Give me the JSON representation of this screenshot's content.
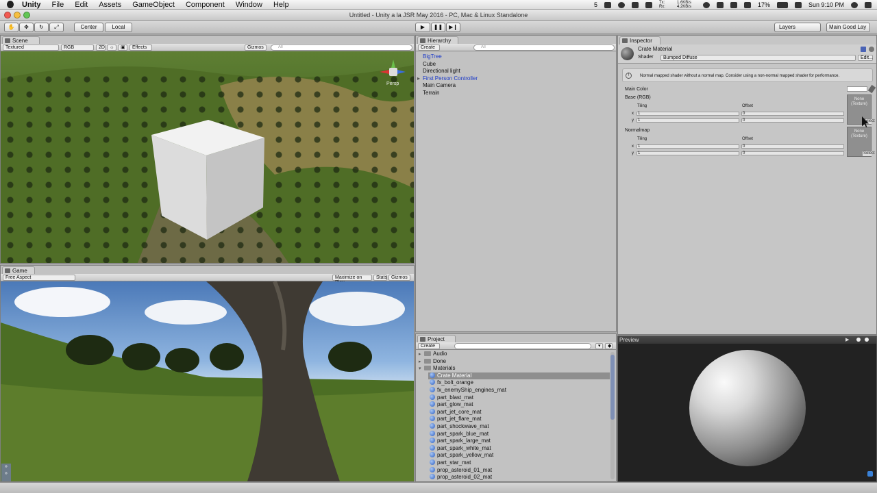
{
  "menubar": {
    "app": "Unity",
    "items": [
      "File",
      "Edit",
      "Assets",
      "GameObject",
      "Component",
      "Window",
      "Help"
    ],
    "status": {
      "counter": "5",
      "network": "1.6KB/s 4.2KB/s",
      "network_labels": "Tx: Rx:",
      "battery": "17%",
      "clock": "Sun 9:10 PM"
    }
  },
  "window": {
    "title": "Untitled - Unity a la JSR May 2016 - PC, Mac & Linux Standalone"
  },
  "toolbar": {
    "pivot": "Center",
    "space": "Local",
    "layers": "Layers",
    "layout": "Main Good Lay"
  },
  "scene": {
    "tab": "Scene",
    "render_mode": "Textured",
    "color_mode": "RGB",
    "mode_2d": "2D",
    "effects": "Effects",
    "gizmos": "Gizmos",
    "search_placeholder": "All",
    "view_label": "Persp"
  },
  "game": {
    "tab": "Game",
    "aspect": "Free Aspect",
    "maximize": "Maximize on Play",
    "stats": "Stats",
    "gizmos": "Gizmos"
  },
  "hierarchy": {
    "tab": "Hierarchy",
    "create": "Create",
    "search_placeholder": "All",
    "items": [
      {
        "label": "BigTree",
        "blue": true
      },
      {
        "label": "Cube",
        "blue": false
      },
      {
        "label": "Directional light",
        "blue": false
      },
      {
        "label": "First Person Controller",
        "blue": true
      },
      {
        "label": "Main Camera",
        "blue": false
      },
      {
        "label": "Terrain",
        "blue": false
      }
    ]
  },
  "project": {
    "tab": "Project",
    "create": "Create",
    "folders": [
      "Audio",
      "Done",
      "Materials"
    ],
    "materials": [
      "Crate Material",
      "fx_bolt_orange",
      "fx_enemyShip_engines_mat",
      "part_blast_mat",
      "part_glow_mat",
      "part_jet_core_mat",
      "part_jet_flare_mat",
      "part_shockwave_mat",
      "part_spark_blue_mat",
      "part_spark_large_mat",
      "part_spark_white_mat",
      "part_spark_yellow_mat",
      "part_star_mat",
      "prop_asteroid_01_mat",
      "prop_asteroid_02_mat"
    ],
    "selected": "Crate Material"
  },
  "inspector": {
    "tab": "Inspector",
    "material_name": "Crate Material",
    "shader_label": "Shader",
    "shader": "Bumped Diffuse",
    "edit": "Edit...",
    "warning": "Normal mapped shader without a normal map. Consider using a non-normal mapped shader for performance.",
    "main_color": "Main Color",
    "base_label": "Base (RGB)",
    "normalmap_label": "Normalmap",
    "tiling": "Tiling",
    "offset": "Offset",
    "x": "x",
    "y": "y",
    "base": {
      "tiling_x": "1",
      "tiling_y": "1",
      "offset_x": "0",
      "offset_y": "0"
    },
    "normal": {
      "tiling_x": "1",
      "tiling_y": "1",
      "offset_x": "0",
      "offset_y": "0"
    },
    "texture_none": "None",
    "texture_type": "(Texture)",
    "select": "Select"
  },
  "preview": {
    "label": "Preview"
  },
  "colors": {
    "highlight_blue": "#1c3ac8",
    "panel_gray": "#c2c2c2",
    "preview_bg": "#222222"
  }
}
